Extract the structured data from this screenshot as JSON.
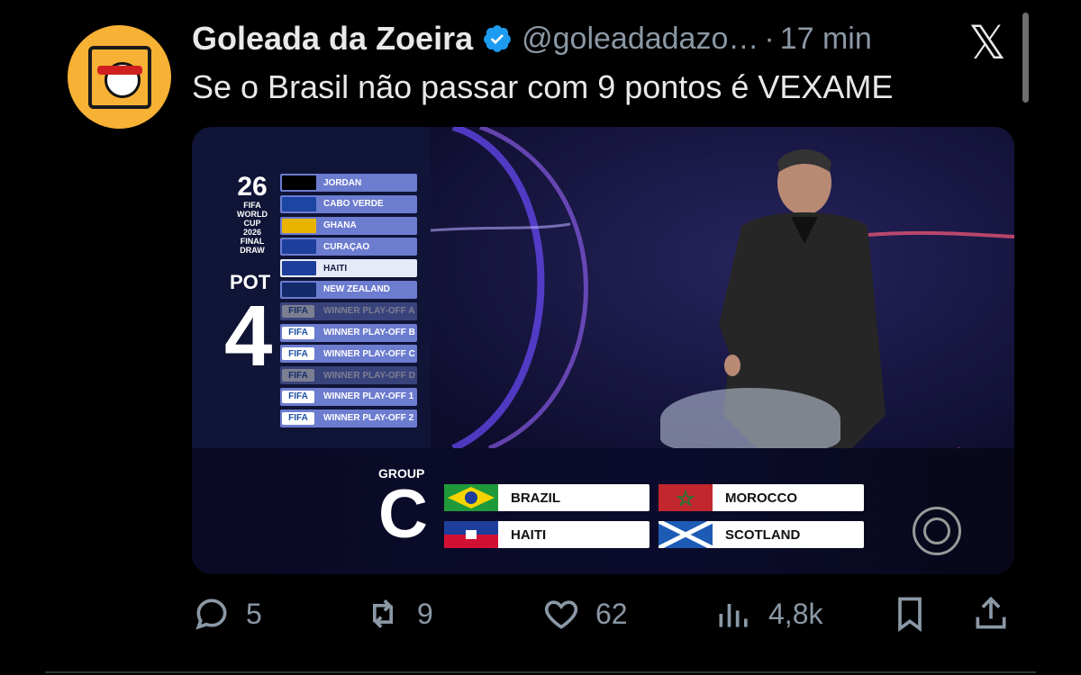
{
  "tweet": {
    "author_name": "Goleada da Zoeira",
    "handle": "@goleadadazo…",
    "separator": "·",
    "time": "17 min",
    "text": "Se o Brasil não passar com 9 pontos é VEXAME"
  },
  "media": {
    "logo": {
      "line1": "26",
      "line2": "FIFA",
      "line3": "WORLD CUP",
      "line4": "2026",
      "line5": "FINAL DRAW"
    },
    "pot": {
      "label": "POT",
      "number": "4"
    },
    "pot_teams": [
      {
        "name": "JORDAN",
        "kind": "flag",
        "state": "normal",
        "color": "#000000"
      },
      {
        "name": "CABO VERDE",
        "kind": "flag",
        "state": "normal",
        "color": "#1b46a3"
      },
      {
        "name": "GHANA",
        "kind": "flag",
        "state": "normal",
        "color": "#e8b400"
      },
      {
        "name": "CURAÇAO",
        "kind": "flag",
        "state": "normal",
        "color": "#1d3f9b"
      },
      {
        "name": "HAITI",
        "kind": "flag",
        "state": "drawn",
        "color": "#1d3f9b"
      },
      {
        "name": "NEW ZEALAND",
        "kind": "flag",
        "state": "normal",
        "color": "#132a6b"
      },
      {
        "name": "WINNER PLAY-OFF A",
        "kind": "fifa",
        "state": "dim",
        "badge": "FIFA"
      },
      {
        "name": "WINNER PLAY-OFF B",
        "kind": "fifa",
        "state": "normal",
        "badge": "FIFA"
      },
      {
        "name": "WINNER PLAY-OFF C",
        "kind": "fifa",
        "state": "normal",
        "badge": "FIFA"
      },
      {
        "name": "WINNER PLAY-OFF D",
        "kind": "fifa",
        "state": "dim",
        "badge": "FIFA"
      },
      {
        "name": "WINNER PLAY-OFF 1",
        "kind": "fifa",
        "state": "normal",
        "badge": "FIFA"
      },
      {
        "name": "WINNER PLAY-OFF 2",
        "kind": "fifa",
        "state": "normal",
        "badge": "FIFA"
      }
    ],
    "group": {
      "label": "GROUP",
      "letter": "C",
      "teams": [
        {
          "name": "BRAZIL",
          "flag_color": "#1f9a3b"
        },
        {
          "name": "MOROCCO",
          "flag_color": "#c1272d"
        },
        {
          "name": "HAITI",
          "flag_color": "#1d3f9b"
        },
        {
          "name": "SCOTLAND",
          "flag_color": "#1d5bb5"
        }
      ]
    }
  },
  "actions": {
    "replies": "5",
    "retweets": "9",
    "likes": "62",
    "views": "4,8k"
  },
  "colors": {
    "background": "#000000",
    "text": "#e7e9ea",
    "muted": "#8b98a5",
    "verified": "#1d9bf0",
    "avatar_bg": "#f7b135"
  }
}
